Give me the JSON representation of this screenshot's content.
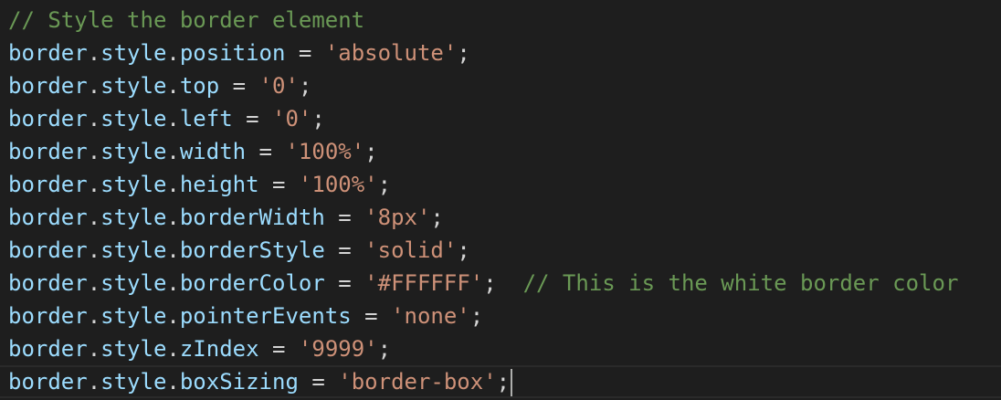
{
  "editor": {
    "lines": [
      {
        "comment": "// Style the border element"
      },
      {
        "obj": "border",
        "dot1": ".",
        "style": "style",
        "dot2": ".",
        "prop": "position",
        "eq": " = ",
        "value": "'absolute'",
        "semi": ";"
      },
      {
        "obj": "border",
        "dot1": ".",
        "style": "style",
        "dot2": ".",
        "prop": "top",
        "eq": " = ",
        "value": "'0'",
        "semi": ";"
      },
      {
        "obj": "border",
        "dot1": ".",
        "style": "style",
        "dot2": ".",
        "prop": "left",
        "eq": " = ",
        "value": "'0'",
        "semi": ";"
      },
      {
        "obj": "border",
        "dot1": ".",
        "style": "style",
        "dot2": ".",
        "prop": "width",
        "eq": " = ",
        "value": "'100%'",
        "semi": ";"
      },
      {
        "obj": "border",
        "dot1": ".",
        "style": "style",
        "dot2": ".",
        "prop": "height",
        "eq": " = ",
        "value": "'100%'",
        "semi": ";"
      },
      {
        "obj": "border",
        "dot1": ".",
        "style": "style",
        "dot2": ".",
        "prop": "borderWidth",
        "eq": " = ",
        "value": "'8px'",
        "semi": ";"
      },
      {
        "obj": "border",
        "dot1": ".",
        "style": "style",
        "dot2": ".",
        "prop": "borderStyle",
        "eq": " = ",
        "value": "'solid'",
        "semi": ";"
      },
      {
        "obj": "border",
        "dot1": ".",
        "style": "style",
        "dot2": ".",
        "prop": "borderColor",
        "eq": " = ",
        "value": "'#FFFFFF'",
        "semi": ";",
        "trailing_comment": "  // This is the white border color"
      },
      {
        "obj": "border",
        "dot1": ".",
        "style": "style",
        "dot2": ".",
        "prop": "pointerEvents",
        "eq": " = ",
        "value": "'none'",
        "semi": ";"
      },
      {
        "obj": "border",
        "dot1": ".",
        "style": "style",
        "dot2": ".",
        "prop": "zIndex",
        "eq": " = ",
        "value": "'9999'",
        "semi": ";"
      },
      {
        "obj": "border",
        "dot1": ".",
        "style": "style",
        "dot2": ".",
        "prop": "boxSizing",
        "eq": " = ",
        "value": "'border-box'",
        "semi": ";"
      }
    ]
  },
  "colors": {
    "background": "#1e1e1e",
    "comment": "#6a9955",
    "variable": "#9cdcfe",
    "string": "#ce9178",
    "punctuation": "#d4d4d4"
  }
}
